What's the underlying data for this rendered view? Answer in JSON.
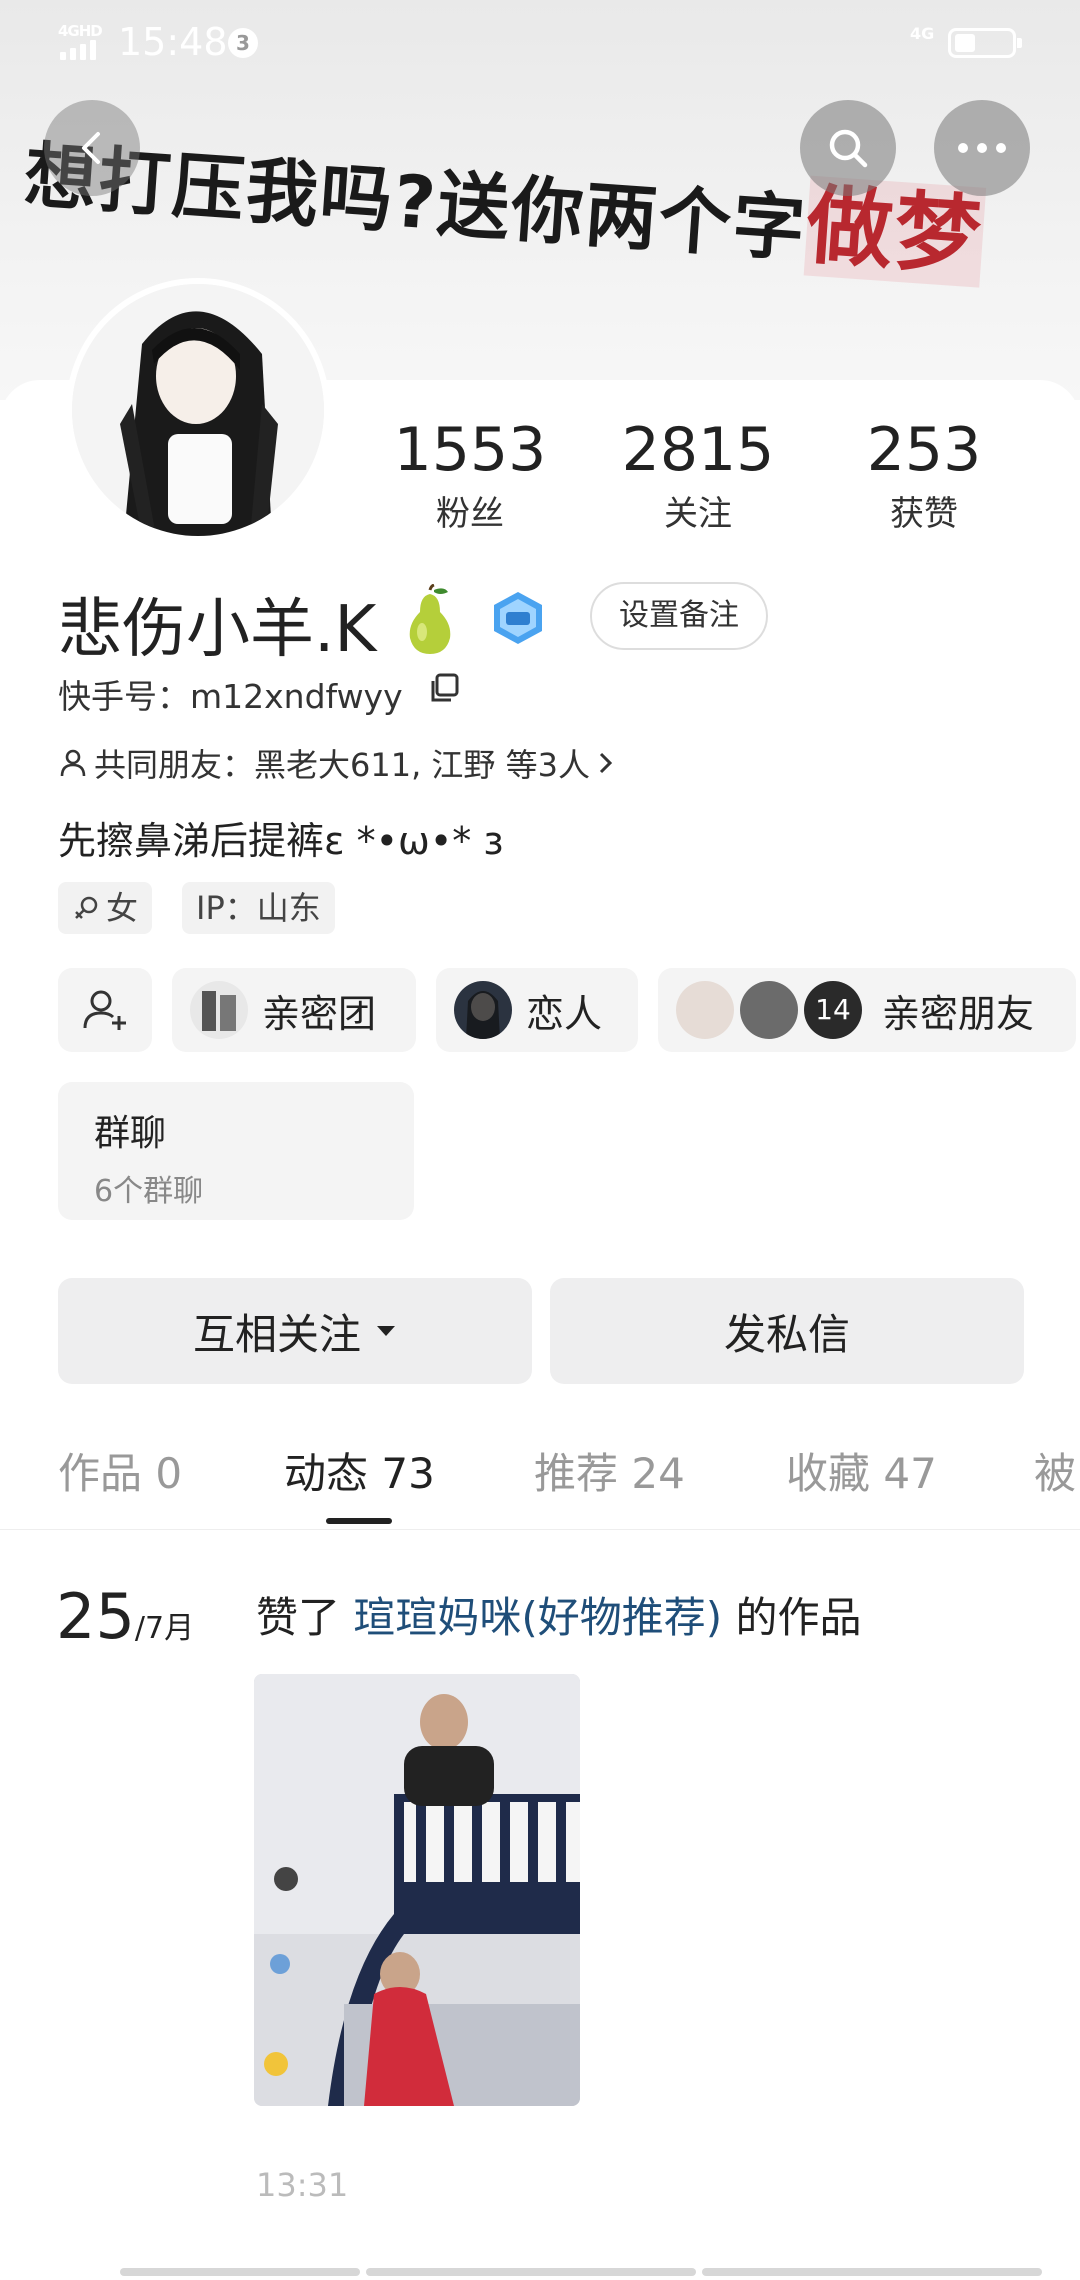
{
  "status_bar": {
    "network": "4GHD",
    "time": "15:48",
    "badge": "3",
    "right_network": "4G"
  },
  "banner": {
    "text_main": "想打压我吗?送你两个字",
    "text_highlight": "做梦"
  },
  "profile": {
    "stats": [
      {
        "value": "1553",
        "label": "粉丝"
      },
      {
        "value": "2815",
        "label": "关注"
      },
      {
        "value": "253",
        "label": "获赞"
      }
    ],
    "name": "悲伤小羊.K",
    "remark_button": "设置备注",
    "kuaishou_id": "快手号：m12xndfwyy",
    "mutual_friends": "共同朋友：黑老大611, 江野 等3人",
    "bio": "先擦鼻涕后提裤ε *•ω•* ɜ",
    "tags": [
      "女",
      "IP：山东"
    ]
  },
  "circles": {
    "intimate_group": "亲密团",
    "lover": "恋人",
    "close_friends_count": "14",
    "close_friends": "亲密朋友"
  },
  "group_chat": {
    "title": "群聊",
    "subtitle": "6个群聊"
  },
  "actions": {
    "follow": "互相关注",
    "message": "发私信"
  },
  "tabs": [
    {
      "label": "作品 0"
    },
    {
      "label": "动态 73"
    },
    {
      "label": "推荐 24"
    },
    {
      "label": "收藏 47"
    },
    {
      "label": "被"
    }
  ],
  "feed": {
    "day": "25",
    "month": "/7月",
    "prefix": "赞了 ",
    "author": "瑄瑄妈咪(好物推荐)",
    "suffix": " 的作品",
    "time": "13:31"
  }
}
